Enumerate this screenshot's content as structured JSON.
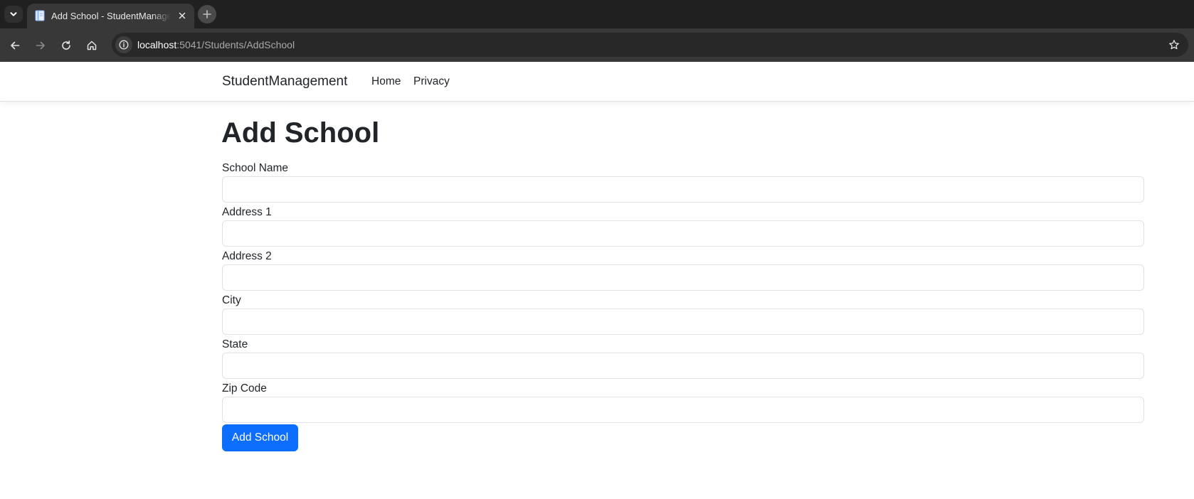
{
  "browser": {
    "tab": {
      "title": "Add School - StudentManagement",
      "favicon": "document-icon"
    },
    "url": {
      "host": "localhost",
      "rest": ":5041/Students/AddSchool"
    },
    "icons": {
      "tab_search": "chevron-down-icon",
      "tab_close": "close-icon",
      "new_tab": "plus-icon",
      "back": "back-arrow-icon",
      "forward": "forward-arrow-icon",
      "reload": "reload-icon",
      "home": "home-icon",
      "site_info": "info-icon",
      "bookmark": "star-icon"
    }
  },
  "navbar": {
    "brand": "StudentManagement",
    "links": [
      "Home",
      "Privacy"
    ]
  },
  "page": {
    "heading": "Add School",
    "fields": [
      {
        "label": "School Name",
        "value": ""
      },
      {
        "label": "Address 1",
        "value": ""
      },
      {
        "label": "Address 2",
        "value": ""
      },
      {
        "label": "City",
        "value": ""
      },
      {
        "label": "State",
        "value": ""
      },
      {
        "label": "Zip Code",
        "value": ""
      }
    ],
    "submit_label": "Add School"
  },
  "colors": {
    "primary_button": "#0d6efd",
    "text": "#212529",
    "input_border": "#dee2e6",
    "tabstrip": "#202020",
    "toolbar": "#383838"
  }
}
